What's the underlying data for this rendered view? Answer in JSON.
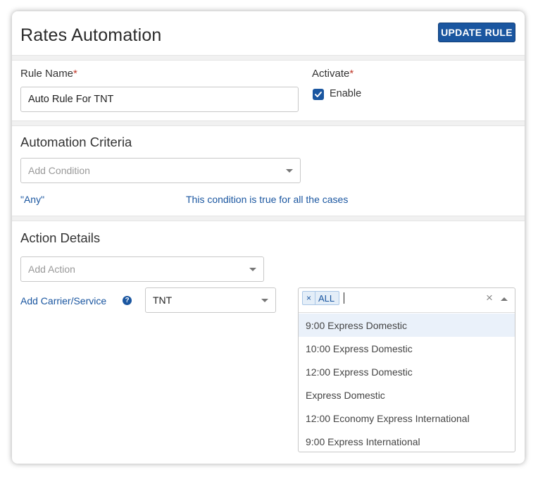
{
  "header": {
    "title": "Rates Automation",
    "update_button": "UPDATE RULE"
  },
  "rule": {
    "name_label": "Rule Name",
    "required_mark": "*",
    "name_value": "Auto Rule For TNT",
    "activate_label": "Activate",
    "enable_label": "Enable",
    "enabled": true
  },
  "criteria": {
    "title": "Automation Criteria",
    "condition_placeholder": "Add Condition",
    "any_text": "\"Any\"",
    "any_description": "This condition is true for all the cases"
  },
  "action": {
    "title": "Action Details",
    "action_placeholder": "Add Action",
    "carrier_label": "Add Carrier/Service",
    "help_icon": "?",
    "carrier_value": "TNT",
    "service_tag": "ALL",
    "tag_remove": "×",
    "clear_symbol": "×",
    "options": [
      "9:00 Express Domestic",
      "10:00 Express Domestic",
      "12:00 Express Domestic",
      "Express Domestic",
      "12:00 Economy Express International",
      "9:00 Express International"
    ]
  },
  "colors": {
    "accent": "#1a56a0",
    "required": "#c0392b",
    "highlight": "#eaf1fa"
  },
  "icons": [
    "check-icon",
    "chevron-down-icon",
    "chevron-up-icon",
    "question-circle-icon",
    "close-icon"
  ]
}
